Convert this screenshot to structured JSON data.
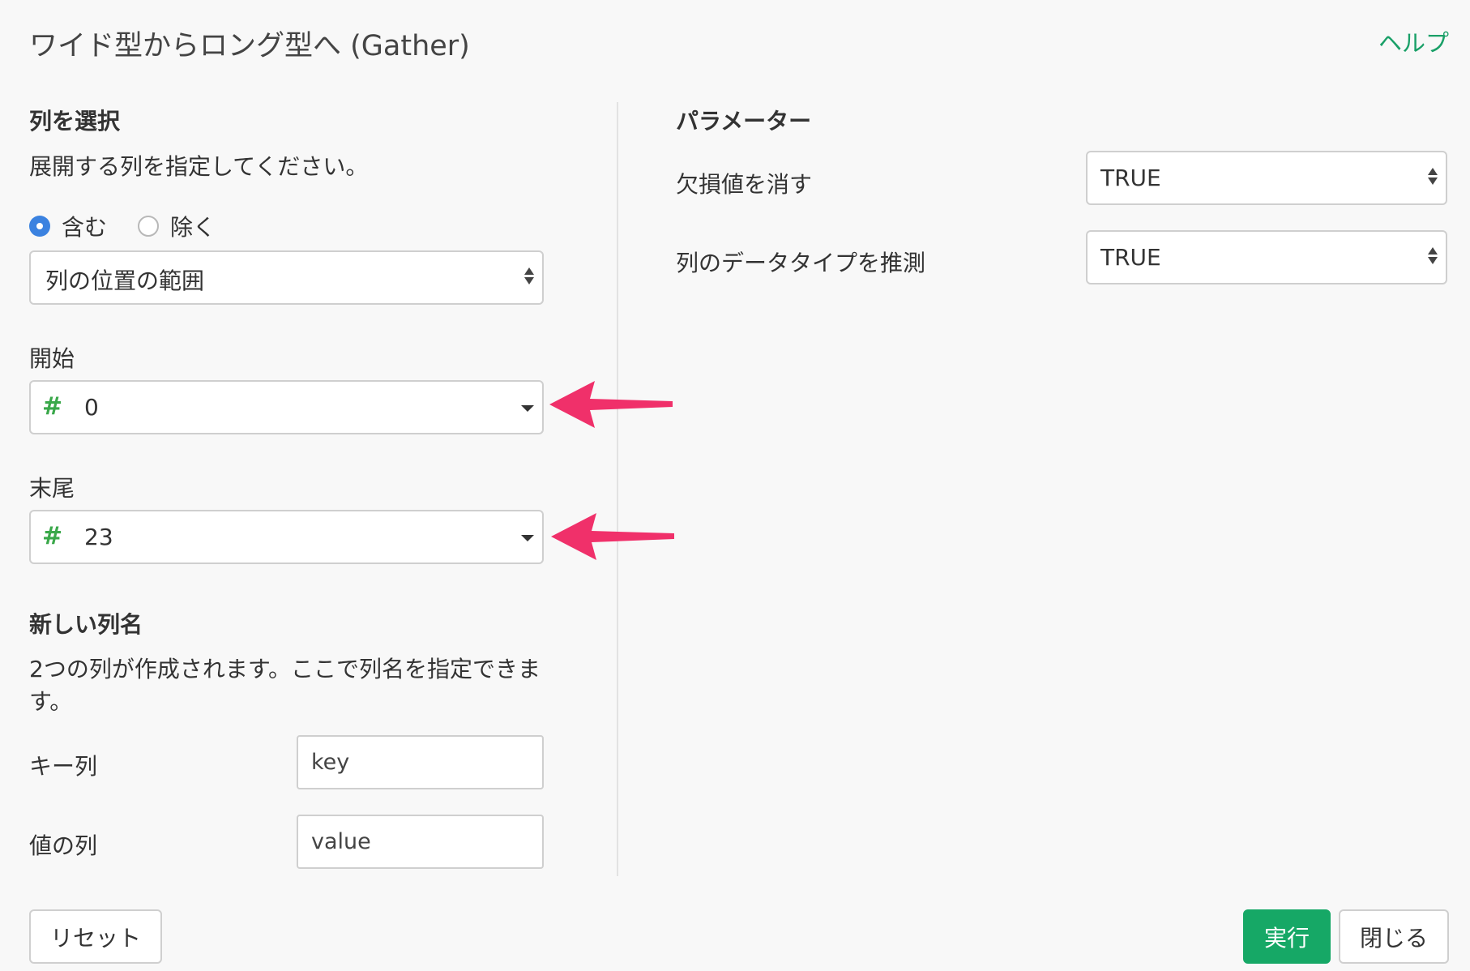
{
  "dialog": {
    "title": "ワイド型からロング型へ (Gather)",
    "help_label": "ヘルプ"
  },
  "left": {
    "select_columns": {
      "title": "列を選択",
      "description": "展開する列を指定してください。",
      "radio_include": "含む",
      "radio_exclude": "除く",
      "selected_radio": "含む",
      "mode_value": "列の位置の範囲"
    },
    "start": {
      "label": "開始",
      "type_icon": "#",
      "value": "0"
    },
    "end": {
      "label": "末尾",
      "type_icon": "#",
      "value": "23"
    },
    "new_columns": {
      "title": "新しい列名",
      "description": "2つの列が作成されます。ここで列名を指定できます。",
      "key_label": "キー列",
      "key_value": "key",
      "value_label": "値の列",
      "value_value": "value"
    }
  },
  "right": {
    "parameters": {
      "title": "パラメーター",
      "remove_missing_label": "欠損値を消す",
      "remove_missing_value": "TRUE",
      "guess_type_label": "列のデータタイプを推測",
      "guess_type_value": "TRUE"
    }
  },
  "footer": {
    "reset_label": "リセット",
    "run_label": "実行",
    "close_label": "閉じる"
  },
  "colors": {
    "accent_green": "#16a866",
    "link_green": "#1aa068",
    "type_icon_green": "#3aa84a",
    "radio_blue": "#3b82e0",
    "arrow_pink": "#f0306a"
  }
}
